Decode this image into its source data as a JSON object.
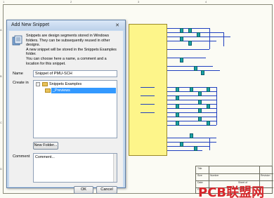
{
  "dialog": {
    "title": "Add New Snippet",
    "close_glyph": "✕",
    "info_text": "Snippets are design segments stored in Windows folders. They can be subsequently reused in other designs.\nA new snippet will be stored in the Snippets Examples folder.\nYou can choose here a name, a comment and a location for this snippet.",
    "name_label": "Name",
    "name_value": "Snippet of PMU-SCH",
    "create_in_label": "Create in",
    "tree": [
      {
        "label": "Snippets Examples",
        "expanded": true
      },
      {
        "label": "_Previews",
        "selected": true
      }
    ],
    "new_folder_button": "New Folder...",
    "comment_label": "Comment",
    "comment_value": "Comment...",
    "ok_button": "OK",
    "cancel_button": "Cancel"
  },
  "schematic": {
    "title_block": {
      "title_label": "Title",
      "size_label": "Size",
      "number_label": "Number",
      "revision_label": "Revision",
      "date_label": "Date:",
      "file_label": "File:",
      "sheet_label": "Sheet   of",
      "drawn_label": "Drawn By:"
    }
  },
  "watermark": "PCB联盟网",
  "colors": {
    "component_fill": "#fdf58a",
    "wire": "#1f3fbf",
    "chip": "#1aa3a3",
    "selection": "#3399ff",
    "watermark": "#d7262b"
  }
}
